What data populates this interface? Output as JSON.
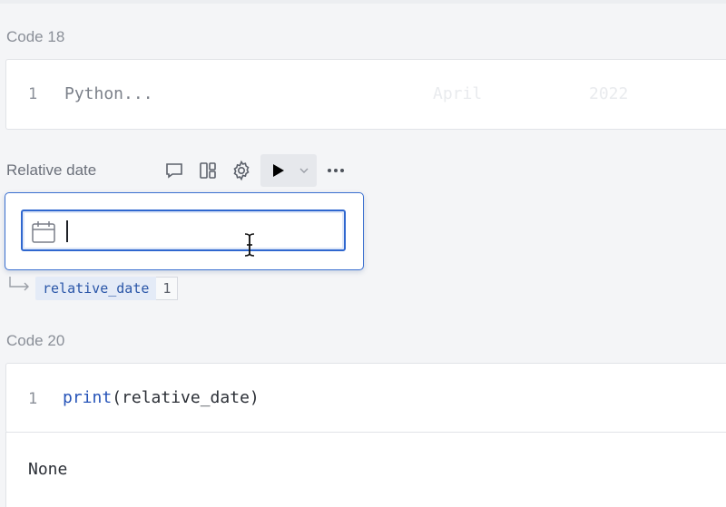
{
  "cell18": {
    "label": "Code 18",
    "line_number": "1",
    "code": "Python..."
  },
  "input_cell": {
    "label": "Relative date",
    "toolbar": [
      "comment-icon",
      "layout-icon",
      "settings-icon",
      "run-icon",
      "chevron-down-icon",
      "more-icon"
    ],
    "date_value": ""
  },
  "variable": {
    "name": "relative_date",
    "count": "1"
  },
  "cell20": {
    "label": "Code 20",
    "line_number": "1",
    "code_fn": "print",
    "code_args": "(relative_date)",
    "output": "None"
  },
  "background_ghost": {
    "month": "April",
    "year": "2022"
  },
  "colors": {
    "accent": "#2f67cf",
    "variable_bg": "#e4ebf7",
    "variable_text": "#2a56a8",
    "keyword": "#2553b8"
  }
}
